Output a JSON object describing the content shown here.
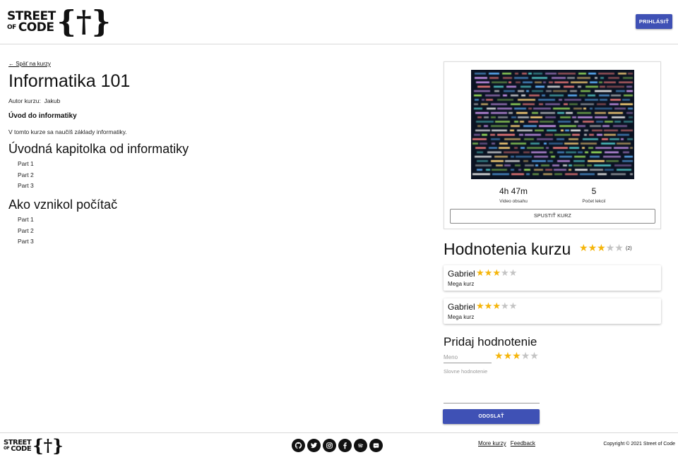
{
  "header": {
    "logo_line1": "STREET",
    "logo_of": "OF",
    "logo_line2": "CODE",
    "logo_brace": "{†}",
    "login_label": "PRIHLÁSIŤ"
  },
  "course": {
    "back_label": "← Späť na kurzy",
    "title": "Informatika 101",
    "author_label": "Autor kurzu:",
    "author_name": "Jakub",
    "intro_heading": "Úvod do informatiky",
    "intro_text": "V tomto kurze sa naučíš základy informatiky.",
    "chapters": [
      {
        "title": "Úvodná kapitolka od informatiky",
        "parts": [
          "Part 1",
          "Part 2",
          "Part 3"
        ]
      },
      {
        "title": "Ako vznikol počítač",
        "parts": [
          "Part 1",
          "Part 2",
          "Part 3"
        ]
      }
    ]
  },
  "card": {
    "image_alt": "code-screen-image",
    "video_value": "4h 47m",
    "video_label": "Video obsahu",
    "lessons_value": "5",
    "lessons_label": "Počet lekcií",
    "start_label": "SPUSTIŤ KURZ"
  },
  "ratings": {
    "title": "Hodnotenia kurzu",
    "average_stars": 3,
    "max_stars": 5,
    "count_label": "(2)",
    "reviews": [
      {
        "name": "Gabriel",
        "stars": 3,
        "text": "Mega kurz"
      },
      {
        "name": "Gabriel",
        "stars": 3,
        "text": "Mega kurz"
      }
    ]
  },
  "add_rating": {
    "title": "Pridaj hodnotenie",
    "name_placeholder": "Meno",
    "name_value": "",
    "stars": 3,
    "comment_placeholder": "Slovne hodnotenie",
    "comment_value": "",
    "submit_label": "ODOSLAŤ"
  },
  "footer": {
    "logo_line1": "STREET",
    "logo_of": "OF",
    "logo_line2": "CODE",
    "logo_brace": "{†}",
    "socials": [
      "github-icon",
      "twitter-icon",
      "instagram-icon",
      "facebook-icon",
      "spotify-icon",
      "discord-icon"
    ],
    "links": [
      "More kurzy",
      "Feedback"
    ],
    "copyright": "Copyright © 2021 Street of Code"
  },
  "colors": {
    "primary": "#3f51b5",
    "star_on": "#f5b50a",
    "star_off": "#c4c4c4"
  }
}
